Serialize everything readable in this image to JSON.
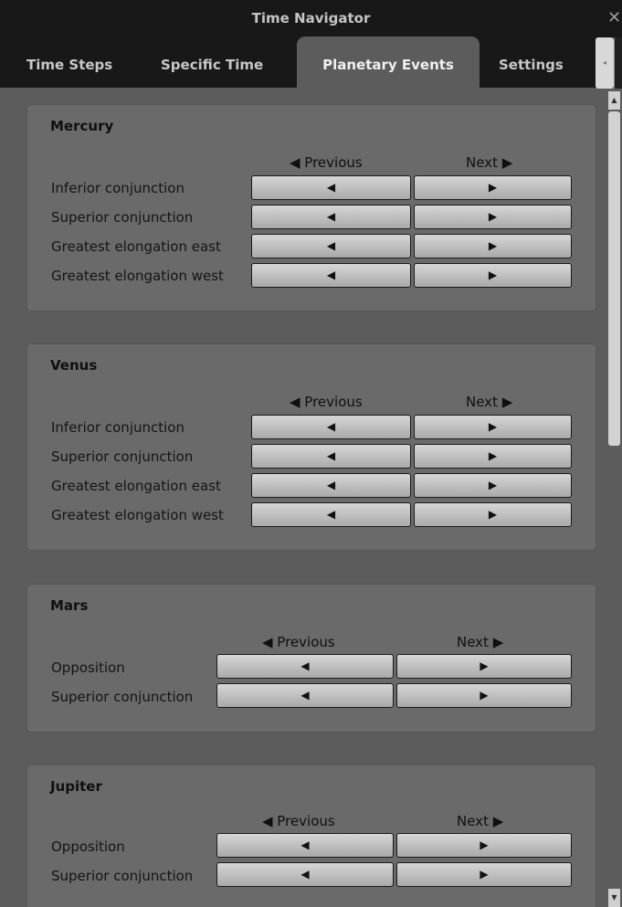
{
  "window": {
    "title": "Time Navigator",
    "close_glyph": "✕"
  },
  "tabs": [
    {
      "label": "Time Steps"
    },
    {
      "label": "Specific Time"
    },
    {
      "label": "Planetary Events"
    },
    {
      "label": "Settings"
    }
  ],
  "tab_scroll_glyph": "◂",
  "header": {
    "previous": "◀ Previous",
    "next": "Next ▶"
  },
  "button_glyphs": {
    "prev": "◀",
    "next": "▶"
  },
  "scroll_glyphs": {
    "up": "▲",
    "down": "▼"
  },
  "groups": [
    {
      "name": "Mercury",
      "rows": [
        "Inferior conjunction",
        "Superior conjunction",
        "Greatest elongation east",
        "Greatest elongation west"
      ]
    },
    {
      "name": "Venus",
      "rows": [
        "Inferior conjunction",
        "Superior conjunction",
        "Greatest elongation east",
        "Greatest elongation west"
      ]
    },
    {
      "name": "Mars",
      "rows": [
        "Opposition",
        "Superior conjunction"
      ]
    },
    {
      "name": "Jupiter",
      "rows": [
        "Opposition",
        "Superior conjunction"
      ]
    }
  ]
}
